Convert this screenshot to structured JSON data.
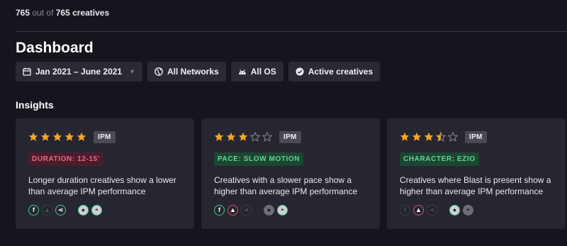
{
  "header": {
    "shown_count": "765",
    "out_of_text": "out of",
    "total_label": "765 creatives",
    "title": "Dashboard"
  },
  "filters": [
    {
      "label": "Jan 2021 – June 2021",
      "icon": "calendar-icon",
      "has_dropdown": true
    },
    {
      "label": "All Networks",
      "icon": "globe-icon"
    },
    {
      "label": "All OS",
      "icon": "android-icon"
    },
    {
      "label": "Active creatives",
      "icon": "check-circle-icon"
    }
  ],
  "insights": {
    "title": "Insights",
    "cards": [
      {
        "rating": 5,
        "badge": "IPM",
        "tag": "DURATION: 12-15'",
        "tag_color": "#ef6a86",
        "text": "Longer duration creatives show a lower than average IPM performance",
        "networks": {
          "facebook": "active",
          "google_ads": "inactive",
          "network": "active"
        },
        "os": {
          "apple": "active",
          "android": "active"
        }
      },
      {
        "rating": 3,
        "badge": "IPM",
        "tag": "PACE: SLOW MOTION",
        "tag_color": "#5fd79a",
        "text": "Creatives with a slower pace show a higher than average IPM performance",
        "networks": {
          "facebook": "active",
          "google_ads": "alert",
          "network": "inactive"
        },
        "os": {
          "apple": "inactive",
          "android": "active"
        }
      },
      {
        "rating": 3.5,
        "badge": "IPM",
        "tag": "CHARACTER: EZIO",
        "tag_color": "#5fd79a",
        "text": "Creatives where Blast is present show a higher than average IPM performance",
        "networks": {
          "facebook": "inactive",
          "google_ads": "alert",
          "network": "inactive"
        },
        "os": {
          "apple": "active",
          "android": "inactive"
        }
      }
    ]
  },
  "colors": {
    "star": "#f5a623",
    "star_empty": "#8a8a94",
    "active_ring": "#3ccf85",
    "alert_ring": "#e14b75"
  }
}
